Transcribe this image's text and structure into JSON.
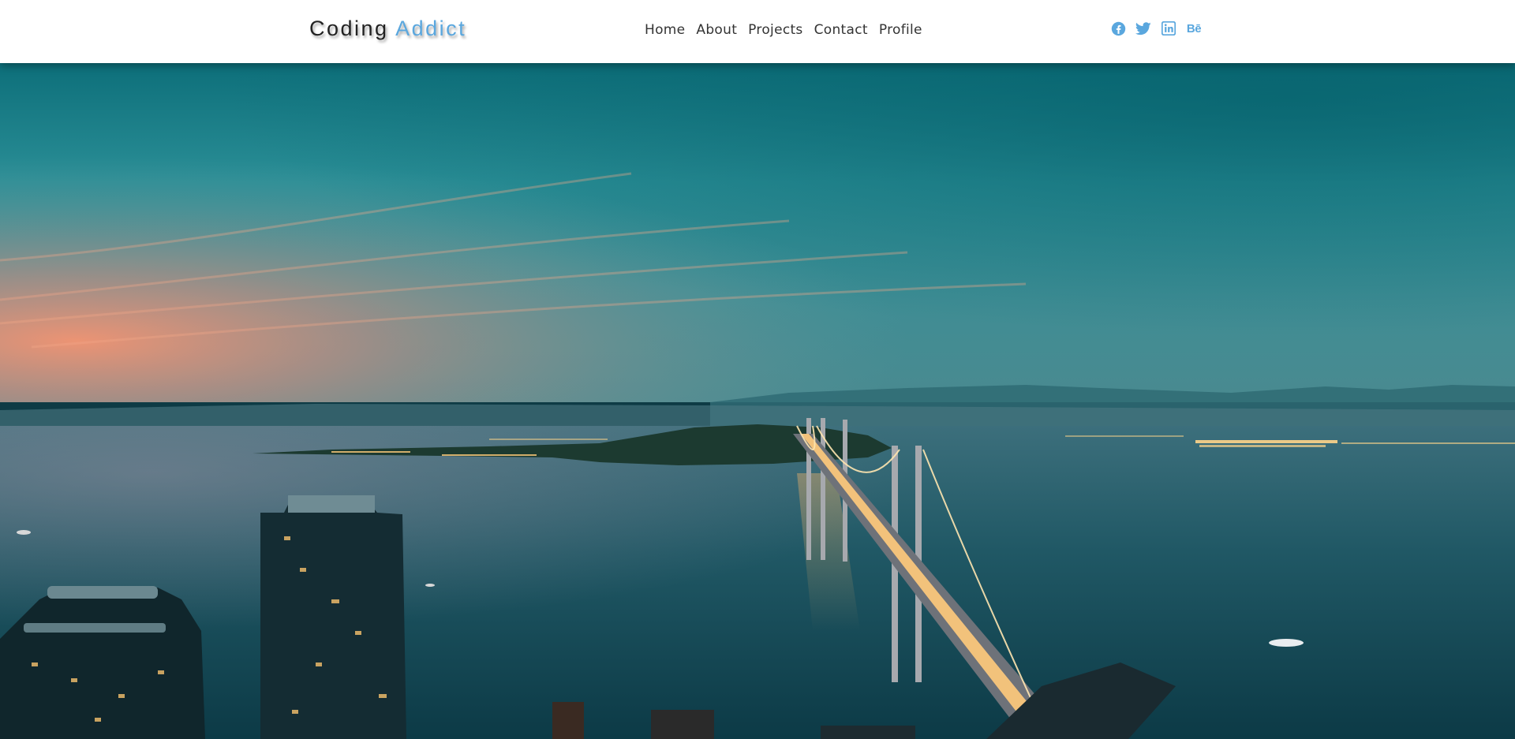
{
  "brand": {
    "name_part1": "Coding",
    "name_part2": "Addict",
    "accent_color": "#5aa7de"
  },
  "nav": {
    "links": [
      {
        "label": "Home"
      },
      {
        "label": "About"
      },
      {
        "label": "Projects"
      },
      {
        "label": "Contact"
      },
      {
        "label": "Profile"
      }
    ]
  },
  "socials": [
    {
      "icon": "facebook-icon"
    },
    {
      "icon": "twitter-icon"
    },
    {
      "icon": "linkedin-icon"
    },
    {
      "icon": "behance-icon",
      "glyph": "Bē"
    }
  ],
  "hero": {
    "image": "city-bridge-at-dusk-photo"
  }
}
